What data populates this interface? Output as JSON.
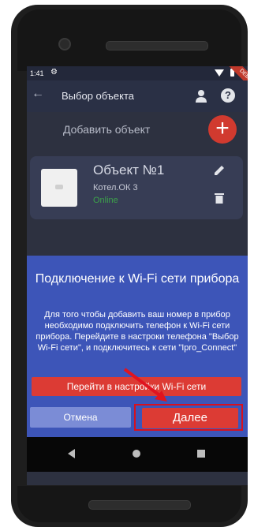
{
  "status_bar": {
    "time": "1:41"
  },
  "ribbon": "DEBUG",
  "app_bar": {
    "title": "Выбор объекта"
  },
  "add_object": {
    "label": "Добавить объект",
    "icon": "plus-icon"
  },
  "object_card": {
    "name": "Объект №1",
    "model": "Котел.ОК 3",
    "status": "Online",
    "status_color": "#3ca24a"
  },
  "dialog": {
    "title": "Подключение к Wi-Fi сети прибора",
    "body": "Для того чтобы добавить ваш номер в прибор необходимо подключить телефон к Wi-Fi сети прибора. Перейдите в настроки телефона \"Выбор Wi-Fi сети\", и подключитесь к сети \"Ipro_Connect\"",
    "wifi_button": "Перейти в настройки Wi-Fi сети",
    "cancel_button": "Отмена",
    "next_button": "Далее"
  },
  "colors": {
    "screen_bg": "#2d3140",
    "dialog_bg": "#3d55b8",
    "accent_red": "#dc3b34",
    "highlight": "#d8101e"
  }
}
